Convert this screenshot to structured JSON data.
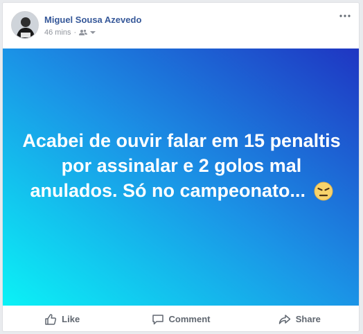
{
  "post": {
    "author": "Miguel Sousa Azevedo",
    "timestamp": "46 mins",
    "audience_icon": "friends-icon",
    "more_icon": "more-options-icon",
    "text": "Acabei de ouvir falar em 15 penaltis por assinalar e 2 golos mal anulados. Só no campeonato...",
    "emoji": "angry-face-emoji",
    "background_gradient": [
      "#0bf2f6",
      "#1b93e6",
      "#1f35c2"
    ]
  },
  "actions": {
    "like_label": "Like",
    "comment_label": "Comment",
    "share_label": "Share"
  },
  "colors": {
    "author": "#365899",
    "meta": "#90949c",
    "action_text": "#606770"
  }
}
